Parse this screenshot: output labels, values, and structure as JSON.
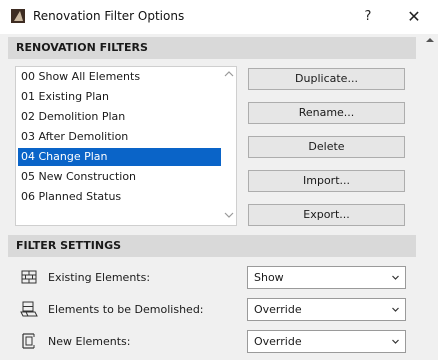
{
  "window": {
    "title": "Renovation Filter Options",
    "help_label": "?",
    "close_label": "✕"
  },
  "renovation_filters": {
    "header": "RENOVATION FILTERS",
    "items": [
      {
        "label": "00 Show All Elements"
      },
      {
        "label": "01 Existing Plan"
      },
      {
        "label": "02 Demolition Plan"
      },
      {
        "label": "03 After Demolition"
      },
      {
        "label": "04 Change Plan"
      },
      {
        "label": "05 New Construction"
      },
      {
        "label": "06 Planned Status"
      }
    ],
    "selected_item": "04 Change Plan",
    "scroll_up_glyph": "^",
    "scroll_down_glyph": "v",
    "buttons": {
      "duplicate": "Duplicate...",
      "rename": "Rename...",
      "delete": "Delete",
      "import": "Import...",
      "export": "Export..."
    }
  },
  "filter_settings": {
    "header": "FILTER SETTINGS",
    "rows": [
      {
        "label": "Existing Elements:",
        "value": "Show",
        "icon": "brick-wall-icon"
      },
      {
        "label": "Elements to be Demolished:",
        "value": "Override",
        "icon": "demolish-icon"
      },
      {
        "label": "New Elements:",
        "value": "Override",
        "icon": "new-element-icon"
      }
    ]
  },
  "colors": {
    "selection": "#0a64c8",
    "section_header_bg": "#d9d9d9",
    "dialog_bg": "#f0f0f0"
  }
}
